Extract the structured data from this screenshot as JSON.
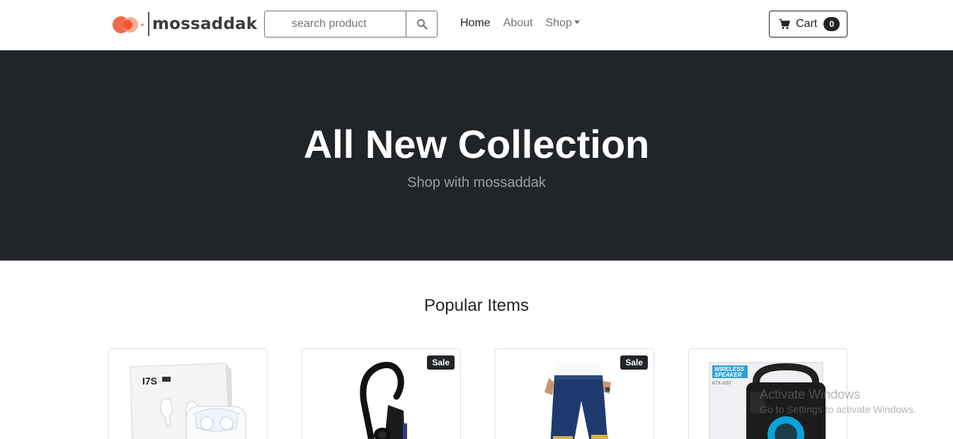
{
  "brand": {
    "name": "mossaddak"
  },
  "search": {
    "placeholder": "search product"
  },
  "nav": {
    "items": [
      {
        "label": "Home"
      },
      {
        "label": "About"
      },
      {
        "label": "Shop"
      }
    ]
  },
  "cart": {
    "label": "Cart",
    "count": "0"
  },
  "hero": {
    "title": "All New Collection",
    "subtitle": "Shop with mossaddak"
  },
  "popular": {
    "title": "Popular Items",
    "products": [
      {
        "image": "i7s-wireless-earbuds",
        "badge": ""
      },
      {
        "image": "bluetooth-earhook-headset",
        "badge": "Sale"
      },
      {
        "image": "denim-jeans",
        "badge": "Sale"
      },
      {
        "image": "wireless-speaker",
        "badge": ""
      }
    ],
    "product_texts": {
      "box_label": "I7S",
      "speaker_label_1": "WIRELESS",
      "speaker_label_2": "SPEAKER",
      "speaker_model": "KTX-1057"
    }
  },
  "watermark": {
    "title": "Activate Windows",
    "subtitle": "Go to Settings to activate Windows."
  },
  "colors": {
    "dark": "#212529",
    "muted": "#6c757d",
    "logo_orange": "#f0694b",
    "logo_light": "#f7a58c"
  }
}
